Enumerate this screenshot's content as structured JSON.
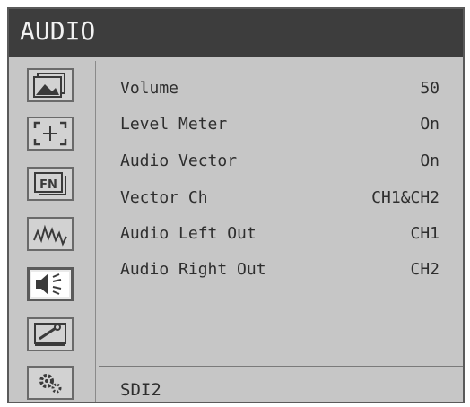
{
  "header": {
    "title": "AUDIO"
  },
  "sidebar": {
    "items": [
      {
        "icon": "picture-icon"
      },
      {
        "icon": "marker-icon"
      },
      {
        "icon": "fn-icon"
      },
      {
        "icon": "waveform-icon"
      },
      {
        "icon": "speaker-icon",
        "active": true
      },
      {
        "icon": "system-setup-icon"
      },
      {
        "icon": "gear-icon"
      }
    ]
  },
  "menu": {
    "rows": [
      {
        "label": "Volume",
        "value": "50"
      },
      {
        "label": "Level Meter",
        "value": "On"
      },
      {
        "label": "Audio Vector",
        "value": "On"
      },
      {
        "label": "Vector Ch",
        "value": "CH1&CH2"
      },
      {
        "label": "Audio Left Out",
        "value": "CH1"
      },
      {
        "label": "Audio Right Out",
        "value": "CH2"
      }
    ]
  },
  "footer": {
    "input_source": "SDI2"
  }
}
